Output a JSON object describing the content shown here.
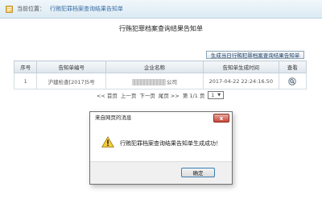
{
  "location": {
    "label": "当前位置：",
    "path": "行贿犯罪档案查询结果告知单"
  },
  "page": {
    "title": "行贿犯罪档案查询结果告知单",
    "generate_button": "生成当日行贿犯罪档案查询结果告知单"
  },
  "table": {
    "headers": [
      "序号",
      "告知单编号",
      "企业名称",
      "告知单生成时间",
      "查看"
    ],
    "rows": [
      {
        "index": "1",
        "number": "沪建检查[2017]5号",
        "company_suffix": "公司",
        "time": "2017-04-22 22:24:16.50"
      }
    ]
  },
  "pager": {
    "first": "<< 首页",
    "prev": "上一页",
    "next": "下一页",
    "last": "尾页 >>",
    "summary": "第 1/1 页",
    "current_page": "1"
  },
  "dialog": {
    "title": "来自网页的消息",
    "message": "行贿犯罪档案查询结果告知单生成成功！",
    "ok_label": "确定",
    "close_glyph": "x"
  },
  "colors": {
    "dialog_border": "#707070",
    "close_button": "#c8473a",
    "ok_button_border": "#3c7fb1",
    "link": "#3a6ea5"
  }
}
